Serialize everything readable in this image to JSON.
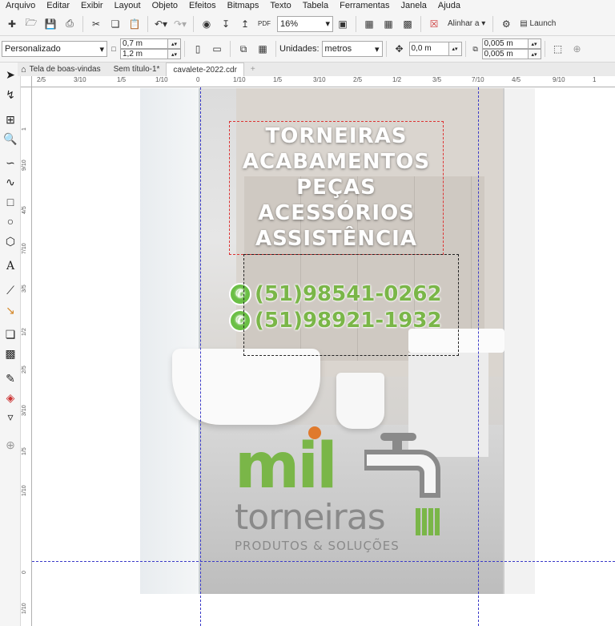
{
  "menu": [
    "Arquivo",
    "Editar",
    "Exibir",
    "Layout",
    "Objeto",
    "Efeitos",
    "Bitmaps",
    "Texto",
    "Tabela",
    "Ferramentas",
    "Janela",
    "Ajuda"
  ],
  "toolbar": {
    "zoom": "16%",
    "pdf_label": "PDF",
    "align_label": "Alinhar a",
    "launch_label": "Launch"
  },
  "propbar": {
    "preset": "Personalizado",
    "width": "0,7 m",
    "height": "1,2 m",
    "units_label": "Unidades:",
    "units_value": "metros",
    "nudge": "0,0 m",
    "dup_x": "0,005 m",
    "dup_y": "0,005 m"
  },
  "tabs": [
    "Tela de boas-vindas",
    "Sem título-1*",
    "cavalete-2022.cdr"
  ],
  "hruler": [
    "2/5",
    "3/10",
    "1/5",
    "1/10",
    "0",
    "1/10",
    "1/5",
    "3/10",
    "2/5",
    "1/2",
    "3/5",
    "7/10",
    "4/5",
    "9/10",
    "1"
  ],
  "vruler": [
    "1",
    "9/10",
    "4/5",
    "7/10",
    "3/5",
    "1/2",
    "2/5",
    "3/10",
    "1/5",
    "1/10",
    "0",
    "1/10"
  ],
  "design": {
    "headline": [
      "TORNEIRAS",
      "ACABAMENTOS",
      "PEÇAS",
      "ACESSÓRIOS",
      "ASSISTÊNCIA"
    ],
    "phones": [
      "(51)98541-0262",
      "(51)98921-1932"
    ],
    "logo_main": "mil",
    "logo_word": "torneiras",
    "logo_sub": "PRODUTOS & SOLUÇÕES"
  },
  "colors": {
    "brand_green": "#7ab648",
    "brand_gray": "#8a8a8a",
    "brand_orange": "#e07a2d",
    "guide": "#3a3ac8"
  }
}
